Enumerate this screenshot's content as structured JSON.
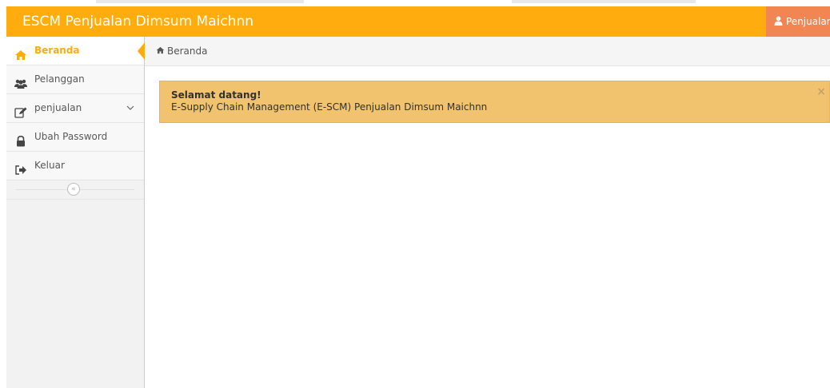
{
  "navbar": {
    "brand": "ESCM Penjualan Dimsum Maichnn",
    "user_label": "Penjualan",
    "user_icon": "user-icon"
  },
  "sidebar": {
    "items": [
      {
        "label": "Beranda",
        "icon": "home-icon",
        "active": true
      },
      {
        "label": "Pelanggan",
        "icon": "users-icon"
      },
      {
        "label": "penjualan",
        "icon": "edit-icon",
        "has_submenu": true
      },
      {
        "label": "Ubah Password",
        "icon": "lock-icon"
      },
      {
        "label": "Keluar",
        "icon": "logout-icon"
      }
    ],
    "collapse_glyph": "«"
  },
  "breadcrumb": {
    "label": "Beranda",
    "icon": "home-icon"
  },
  "alert": {
    "title": "Selamat datang!",
    "message": "E-Supply Chain Management (E-SCM) Penjualan Dimsum Maichnn",
    "close_glyph": "×"
  },
  "colors": {
    "navbar": "#ffac0e",
    "user_menu": "#f28653",
    "alert_bg": "#f1c36e",
    "active_accent": "#ffac0e"
  }
}
